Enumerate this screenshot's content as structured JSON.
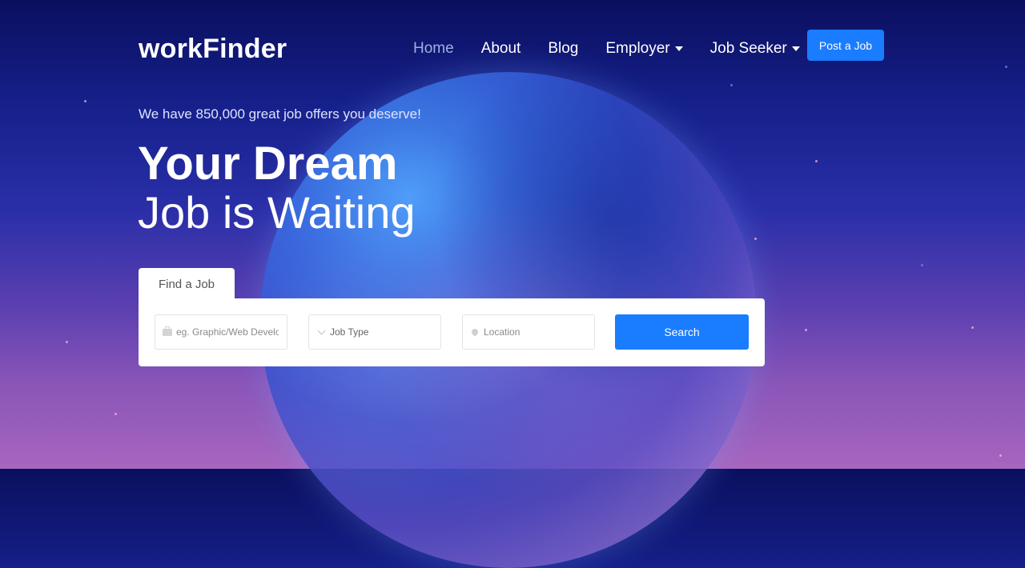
{
  "brand": {
    "name": "workFinder"
  },
  "nav": {
    "items": [
      {
        "label": "Home",
        "active": true
      },
      {
        "label": "About"
      },
      {
        "label": "Blog"
      },
      {
        "label": "Employer",
        "dropdown": true
      },
      {
        "label": "Job Seeker",
        "dropdown": true
      }
    ],
    "post_job_label": "Post a Job"
  },
  "hero": {
    "tagline": "We have 850,000 great job offers you deserve!",
    "title_line1": "Your Dream",
    "title_line2": "Job is Waiting"
  },
  "search": {
    "tab_label": "Find a Job",
    "keyword_placeholder": "eg. Graphic/Web Developer",
    "job_type_label": "Job Type",
    "location_placeholder": "Location",
    "button_label": "Search"
  },
  "colors": {
    "accent": "#1a7cff",
    "bg_top": "#0a0f5e",
    "bg_bottom": "#a766bf"
  },
  "icons": {
    "keyword": "briefcase-icon",
    "job_type": "chevron-down-icon",
    "location": "map-pin-icon",
    "nav_dropdown": "caret-down-icon"
  }
}
